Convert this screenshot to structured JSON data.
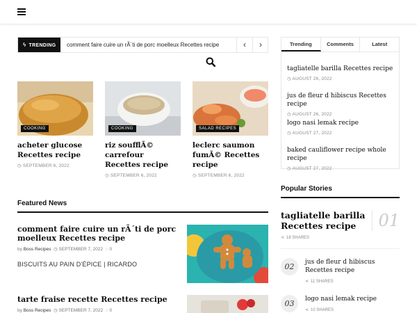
{
  "header": {
    "menu_icon": "hamburger-icon"
  },
  "trending": {
    "label": "TRENDING",
    "headline": "comment faire cuire un rÃ´ti de porc moelleux Recettes recipe",
    "prev_icon": "chevron-left-icon",
    "next_icon": "chevron-right-icon"
  },
  "search": {
    "icon": "search-icon"
  },
  "cards": [
    {
      "category": "COOKING",
      "title": "acheter glucose Recettes recipe",
      "date": "SEPTEMBER 6, 2022"
    },
    {
      "category": "COOKING",
      "title": "riz soufflÃ© carrefour Recettes recipe",
      "date": "SEPTEMBER 6, 2022"
    },
    {
      "category": "SALAD RECIPES",
      "title": "leclerc saumon fumÃ© Recettes recipe",
      "date": "SEPTEMBER 6, 2022"
    }
  ],
  "featured": {
    "heading": "Featured News",
    "items": [
      {
        "title": "comment faire cuire un rÃ´ti de porc moelleux Recettes recipe",
        "by": "by",
        "author": "Boss Recipes",
        "date": "SEPTEMBER 7, 2022",
        "comments": "0",
        "excerpt": "BISCUITS AU PAIN D'ÉPICE | RICARDO"
      },
      {
        "title": "tarte fraise recette Recettes recipe",
        "by": "by",
        "author": "Boss Recipes",
        "date": "SEPTEMBER 7, 2022",
        "comments": "0",
        "excerpt": ""
      }
    ]
  },
  "sidebar": {
    "tabs": [
      {
        "label": "Trending"
      },
      {
        "label": "Comments"
      },
      {
        "label": "Latest"
      }
    ],
    "tab_items": [
      {
        "title": "tagliatelle barilla Recettes recipe",
        "date": "AUGUST 26, 2022"
      },
      {
        "title": "jus de fleur d hibiscus Recettes recipe",
        "date": "AUGUST 26, 2022"
      },
      {
        "title": "logo nasi lemak recipe",
        "date": "AUGUST 27, 2022"
      },
      {
        "title": "baked cauliflower recipe whole recipe",
        "date": "AUGUST 27, 2022"
      }
    ],
    "popular": {
      "heading": "Popular Stories",
      "items": [
        {
          "rank": "01",
          "title": "tagliatelle barilla Recettes recipe",
          "shares": "18 SHARES"
        },
        {
          "rank": "02",
          "title": "jus de fleur d hibiscus Recettes recipe",
          "shares": "11 SHARES"
        },
        {
          "rank": "03",
          "title": "logo nasi lemak recipe",
          "shares": "10 SHARES"
        }
      ]
    }
  },
  "colors": {
    "accent": "#111111",
    "meta": "#888888"
  }
}
